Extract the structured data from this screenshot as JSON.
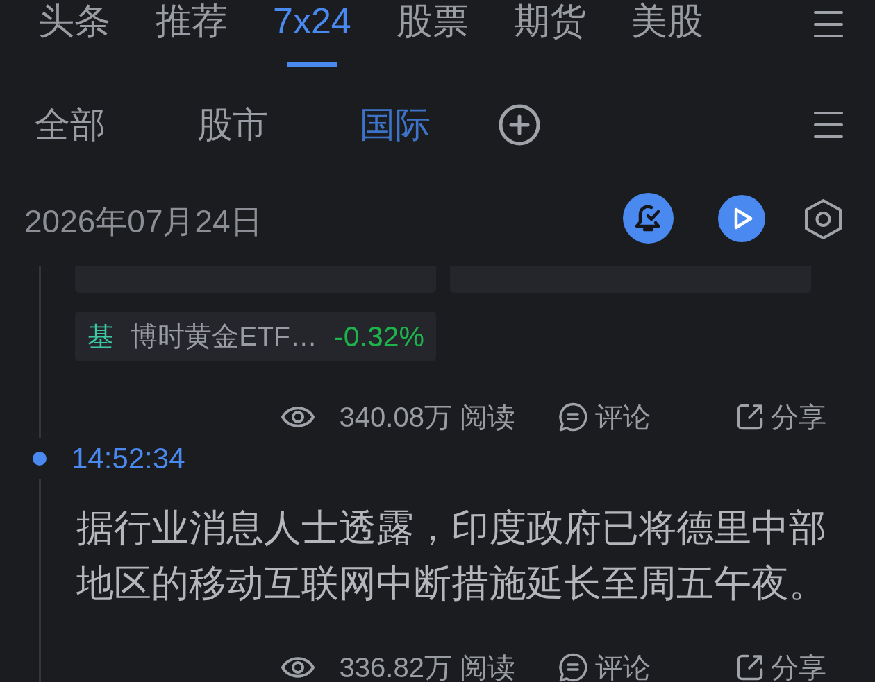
{
  "top_tabs": [
    {
      "label": "头条",
      "selected": false
    },
    {
      "label": "推荐",
      "selected": false
    },
    {
      "label": "7x24",
      "selected": true
    },
    {
      "label": "股票",
      "selected": false
    },
    {
      "label": "期货",
      "selected": false
    },
    {
      "label": "美股",
      "selected": false
    }
  ],
  "sub_tabs": [
    {
      "label": "全部",
      "selected": false
    },
    {
      "label": "股市",
      "selected": false
    },
    {
      "label": "国际",
      "selected": true
    }
  ],
  "date": "2026年07月24日",
  "feed": [
    {
      "quotes": [
        {
          "kind": "cut"
        },
        {
          "kind": "cut"
        },
        {
          "kind": "full",
          "tag": "基",
          "color": "#3ec8a2",
          "name": "博时黄金ETF…",
          "change": "-0.32%",
          "rising": false
        }
      ],
      "reads": "340.08万 阅读",
      "comment": "评论",
      "share": "分享"
    },
    {
      "time": "14:52:34",
      "text": "据行业消息人士透露，印度政府已将德里中部地区的移动互联网中断措施延长至周五午夜。",
      "reads": "336.82万 阅读",
      "comment": "评论",
      "share": "分享"
    }
  ]
}
